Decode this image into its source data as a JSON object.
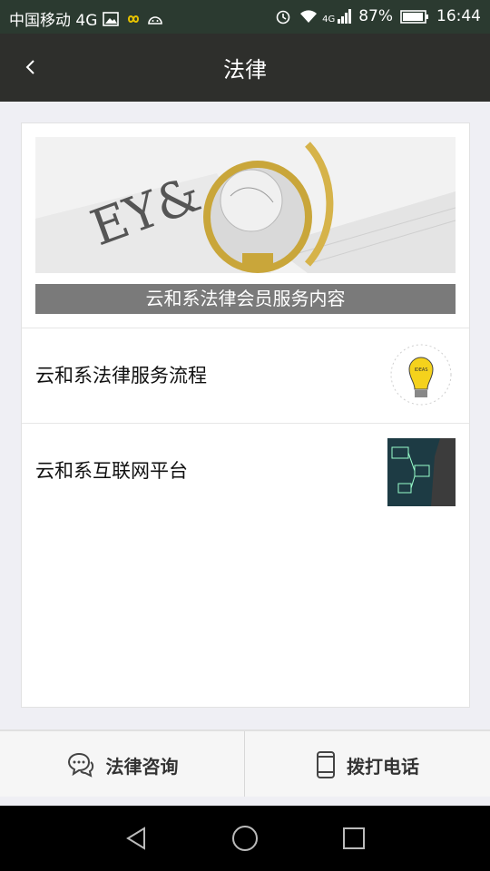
{
  "status_bar": {
    "carrier": "中国移动 4G",
    "signal_label": "4G",
    "battery": "87%",
    "time": "16:44"
  },
  "nav": {
    "title": "法律"
  },
  "card": {
    "hero_caption": "云和系法律会员服务内容",
    "items": [
      {
        "label": "云和系法律服务流程"
      },
      {
        "label": "云和系互联网平台"
      }
    ]
  },
  "bottom_bar": {
    "consult_label": "法律咨询",
    "call_label": "拨打电话"
  },
  "colors": {
    "status_bar_bg": "#2b3a30",
    "nav_bg": "#2e2f2c",
    "caption_bg": "#7a7a7a"
  }
}
